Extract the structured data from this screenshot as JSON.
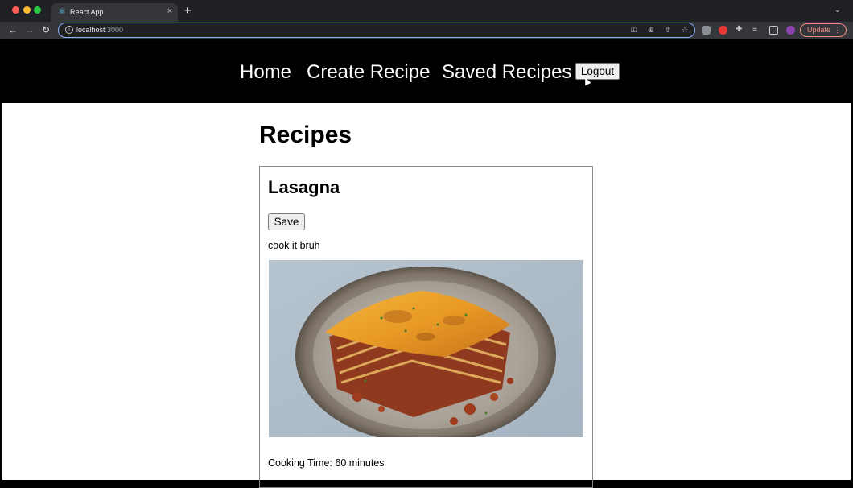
{
  "browser": {
    "tab_title": "React App",
    "url_host": "localhost",
    "url_port": ":3000",
    "update_label": "Update"
  },
  "navbar": {
    "links": [
      "Home",
      "Create Recipe",
      "Saved Recipes"
    ],
    "logout_label": "Logout"
  },
  "page": {
    "title": "Recipes"
  },
  "recipe": {
    "name": "Lasagna",
    "save_label": "Save",
    "instructions": "cook it bruh",
    "cooking_time": "Cooking Time: 60 minutes"
  },
  "colors": {
    "navbar_bg": "#000000",
    "link_color": "#ffffff",
    "omnibox_focus": "#8ab4f8",
    "update_accent": "#f28b82"
  },
  "icons": [
    "react-favicon-icon",
    "close-icon",
    "plus-icon",
    "back-icon",
    "forward-icon",
    "reload-icon",
    "info-icon",
    "key-icon",
    "zoom-icon",
    "share-icon",
    "star-icon",
    "puzzle-icon",
    "profile-avatar-icon"
  ]
}
